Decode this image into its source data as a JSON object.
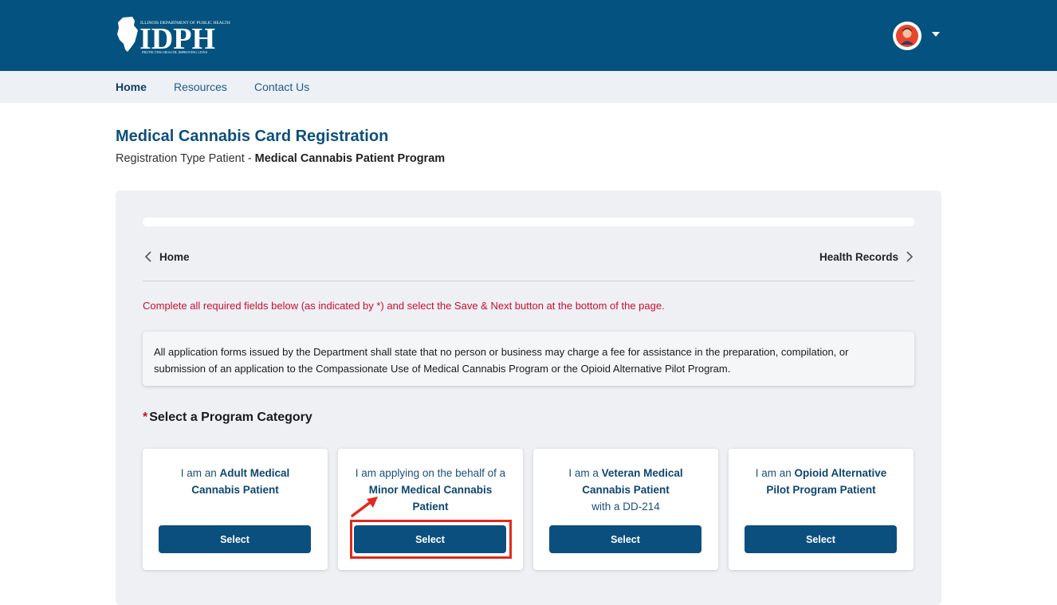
{
  "header": {
    "logo_text": "IDPH",
    "logo_top_line": "ILLINOIS DEPARTMENT OF PUBLIC HEALTH",
    "logo_tagline": "PROTECTING HEALTH, IMPROVING LIVES",
    "avatar_icon": "user-avatar",
    "menu_icon": "caret-down"
  },
  "nav": {
    "home": "Home",
    "resources": "Resources",
    "contact": "Contact Us"
  },
  "page": {
    "title": "Medical Cannabis Card Registration",
    "subtitle_prefix": "Registration Type Patient - ",
    "subtitle_program": "Medical Cannabis Patient Program"
  },
  "steps": {
    "prev_label": "Home",
    "next_label": "Health Records"
  },
  "required_note": "Complete all required fields below (as indicated by *) and select the Save & Next button at the bottom of the page.",
  "notice": "All application forms issued by the Department shall state that no person or business may charge a fee for assistance in the preparation, compilation, or submission of an application to the Compassionate Use of Medical Cannabis Program or the Opioid Alternative Pilot Program.",
  "section": {
    "required_mark": "*",
    "title": "Select a Program Category"
  },
  "cards": [
    {
      "pre": "I am an ",
      "bold": "Adult Medical Cannabis Patient",
      "post": "",
      "button": "Select"
    },
    {
      "pre": "I am applying on the behalf of a ",
      "bold": "Minor Medical Cannabis Patient",
      "post": "",
      "button": "Select"
    },
    {
      "pre": "I am a ",
      "bold": "Veteran Medical Cannabis Patient",
      "post": "with a DD-214",
      "button": "Select"
    },
    {
      "pre": "I am an ",
      "bold": "Opioid Alternative Pilot Program Patient",
      "post": "",
      "button": "Select"
    }
  ],
  "colors": {
    "header_bg": "#03527f",
    "accent": "#0b4f7f",
    "required_red": "#c8102e",
    "annotation_red": "#e02a1d"
  }
}
